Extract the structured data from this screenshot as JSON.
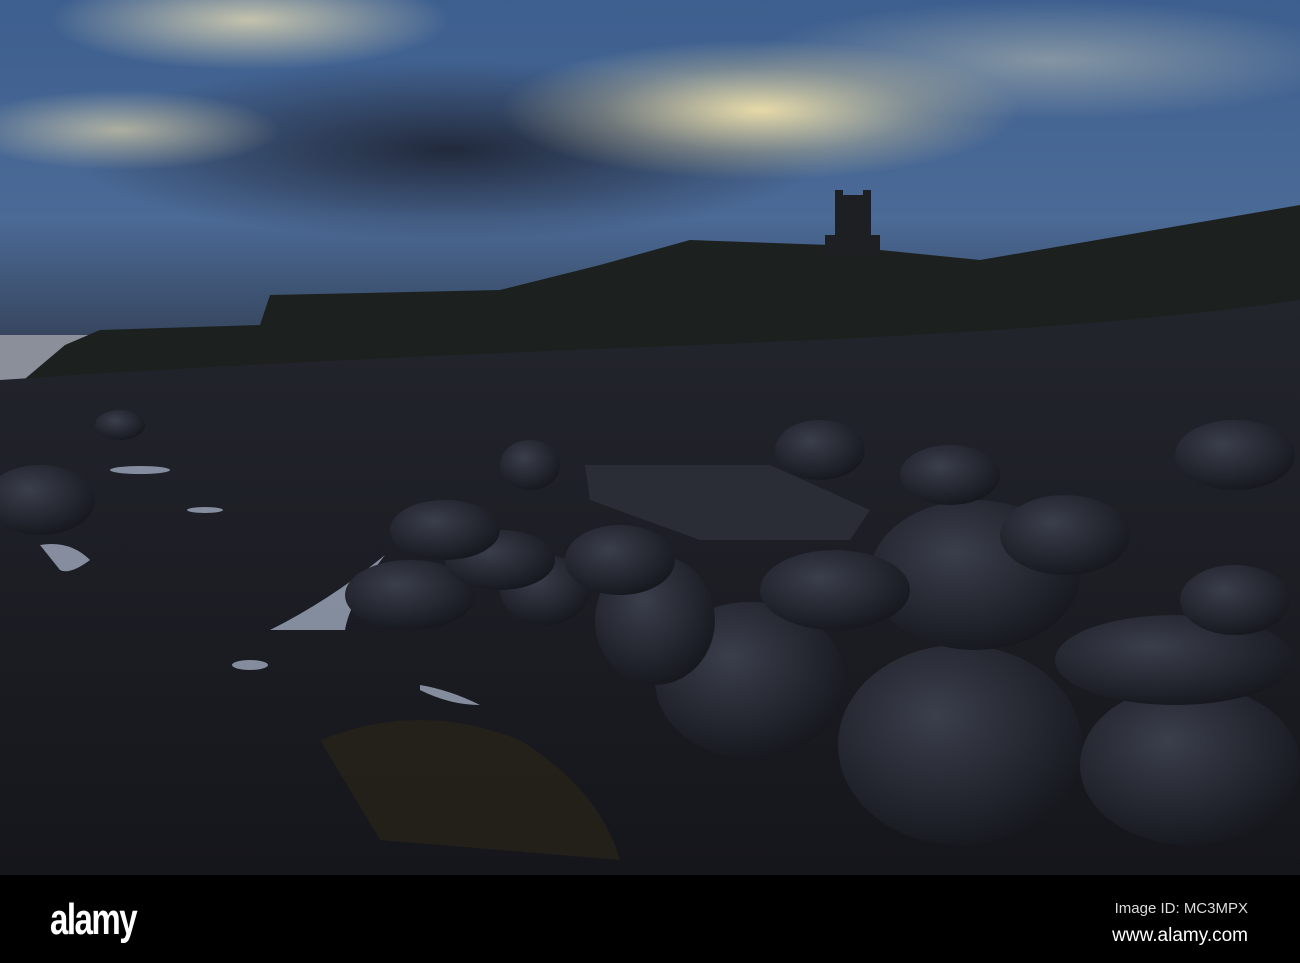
{
  "watermark": {
    "text": "alamy"
  },
  "footer": {
    "logo": "alamy",
    "image_id": "Image ID: MC3MPX",
    "url": "www.alamy.com"
  }
}
